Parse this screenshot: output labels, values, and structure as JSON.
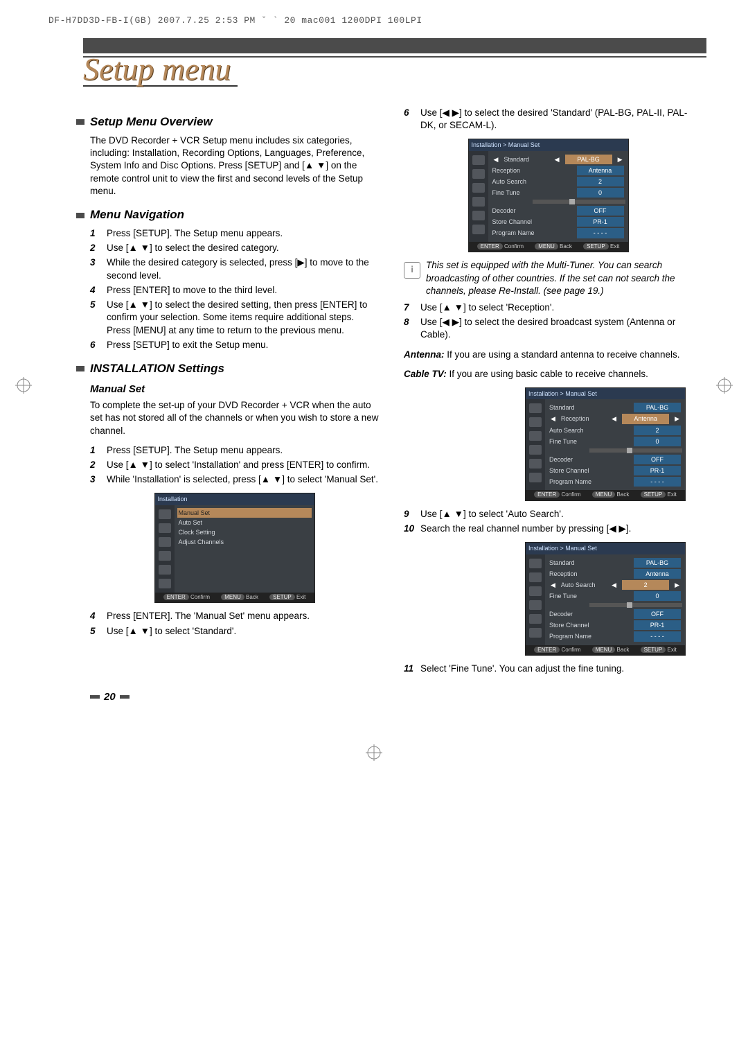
{
  "print_header": "DF-H7DD3D-FB-I(GB)  2007.7.25 2:53 PM  ˇ ` 20   mac001  1200DPI 100LPI",
  "title": "Setup menu",
  "page_number": "20",
  "sec_overview": {
    "heading": "Setup Menu Overview",
    "para": "The DVD Recorder + VCR Setup menu includes six categories, including: Installation, Recording Options, Languages, Preference, System Info and  Disc Options. Press [SETUP] and [▲ ▼] on the remote control unit to view the first and second levels of the Setup menu."
  },
  "sec_nav": {
    "heading": "Menu Navigation",
    "steps": [
      "Press [SETUP]. The Setup menu appears.",
      "Use [▲ ▼] to select the desired category.",
      "While the desired category is selected, press [▶] to move to the second level.",
      "Press [ENTER] to move to the third level.",
      "Use [▲ ▼] to select the desired setting, then press [ENTER] to confirm your selection. Some items require additional steps. Press [MENU] at any time to return to the previous menu.",
      "Press [SETUP] to exit the Setup menu."
    ]
  },
  "sec_install": {
    "heading": "INSTALLATION Settings",
    "sub": "Manual Set",
    "para": "To complete the set-up of your DVD Recorder + VCR when the auto set has not stored all of the channels or when you wish to store a new channel.",
    "steps_a_start": 1,
    "steps_a": [
      "Press [SETUP]. The Setup menu appears.",
      "Use [▲ ▼] to select 'Installation' and press [ENTER] to confirm.",
      "While 'Installation' is selected, press [▲ ▼] to select 'Manual Set'."
    ],
    "steps_b_start": 4,
    "steps_b": [
      "Press [ENTER]. The 'Manual Set' menu appears.",
      "Use [▲ ▼] to select 'Standard'."
    ],
    "step6": "Use [◀ ▶] to select the desired 'Standard' (PAL-BG, PAL-II, PAL-DK, or SECAM-L).",
    "note": "This set is equipped with the Multi-Tuner. You can search broadcasting of other countries. If the set can not search the channels, please Re-Install. (see page 19.)",
    "step7": "Use [▲ ▼] to select 'Reception'.",
    "step8": "Use [◀ ▶] to select the desired broadcast system (Antenna or Cable).",
    "antenna_label": "Antenna:",
    "antenna_text": " If you are using a standard antenna to receive channels.",
    "cable_label": "Cable TV:",
    "cable_text": " If you are using basic cable to receive channels.",
    "step9": "Use [▲ ▼] to select 'Auto Search'.",
    "step10": "Search the real channel number by pressing [◀ ▶].",
    "step11": "Select 'Fine Tune'. You can adjust the fine tuning."
  },
  "osd_common": {
    "crumb_install": "Installation",
    "crumb_manual": "Installation  > Manual Set",
    "foot_enter": "ENTER",
    "foot_confirm": "Confirm",
    "foot_menu": "MENU",
    "foot_back": "Back",
    "foot_setup": "SETUP",
    "foot_exit": "Exit"
  },
  "osd1_rows": [
    {
      "label": "Manual Set",
      "hl": true
    },
    {
      "label": "Auto Set"
    },
    {
      "label": "Clock Setting"
    },
    {
      "label": "Adjust Channels"
    }
  ],
  "osd2_rows": [
    {
      "label": "Standard",
      "value": "PAL-BG",
      "sel": true,
      "arrows": true
    },
    {
      "label": "Reception",
      "value": "Antenna"
    },
    {
      "label": "Auto Search",
      "value": "2"
    },
    {
      "label": "Fine Tune",
      "value": "0"
    },
    {
      "label": "Decoder",
      "value": "OFF"
    },
    {
      "label": "Store Channel",
      "value": "PR-1"
    },
    {
      "label": "Program Name",
      "value": "- - - -"
    }
  ],
  "osd3_rows": [
    {
      "label": "Standard",
      "value": "PAL-BG"
    },
    {
      "label": "Reception",
      "value": "Antenna",
      "sel": true,
      "arrows": true
    },
    {
      "label": "Auto Search",
      "value": "2"
    },
    {
      "label": "Fine Tune",
      "value": "0"
    },
    {
      "label": "Decoder",
      "value": "OFF"
    },
    {
      "label": "Store Channel",
      "value": "PR-1"
    },
    {
      "label": "Program Name",
      "value": "- - - -"
    }
  ],
  "osd4_rows": [
    {
      "label": "Standard",
      "value": "PAL-BG"
    },
    {
      "label": "Reception",
      "value": "Antenna"
    },
    {
      "label": "Auto Search",
      "value": "2",
      "sel": true,
      "arrows": true
    },
    {
      "label": "Fine Tune",
      "value": "0"
    },
    {
      "label": "Decoder",
      "value": "OFF"
    },
    {
      "label": "Store Channel",
      "value": "PR-1"
    },
    {
      "label": "Program Name",
      "value": "- - - -"
    }
  ]
}
